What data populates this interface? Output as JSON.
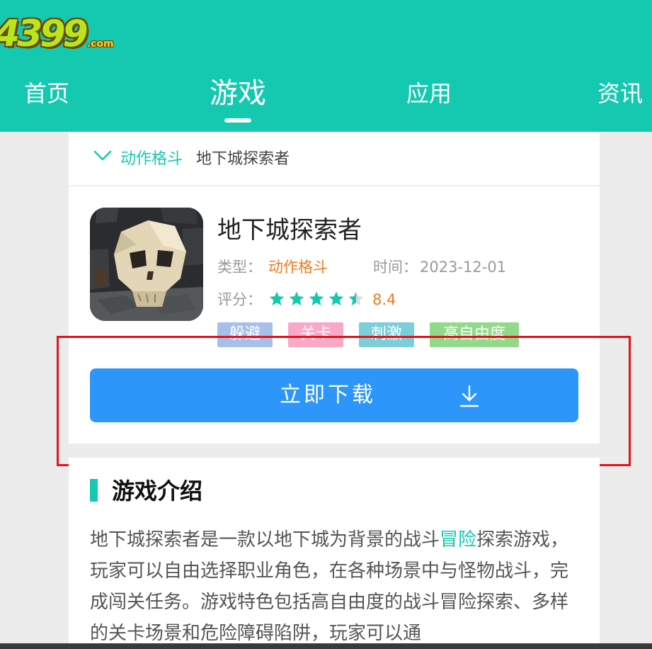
{
  "header": {
    "logo_text": "4399",
    "logo_com": ".com",
    "nav": [
      {
        "label": "首页"
      },
      {
        "label": "游戏"
      },
      {
        "label": "应用"
      },
      {
        "label": "资讯"
      }
    ],
    "active_index": 1,
    "bg_color": "#14c9b0"
  },
  "breadcrumb": {
    "icon": "chevron-down-icon",
    "category": "动作格斗",
    "current": "地下城探索者"
  },
  "game": {
    "title": "地下城探索者",
    "type_label": "类型：",
    "type_value": "动作格斗",
    "time_label": "时间：",
    "time_value": "2023-12-01",
    "rating_label": "评分：",
    "rating_value": "8.4",
    "rating_stars": 4.5,
    "rating_max": 5,
    "tags": [
      {
        "label": "躲避",
        "color": "#a8c0e8"
      },
      {
        "label": "关卡",
        "color": "#f7a9c7"
      },
      {
        "label": "刺激",
        "color": "#7ccfd8"
      },
      {
        "label": "高自由度",
        "color": "#93d98a"
      }
    ],
    "download_label": "立即下载",
    "download_icon": "download-icon"
  },
  "intro": {
    "heading": "游戏介绍",
    "text_before": "地下城探索者是一款以地下城为背景的战斗",
    "link": "冒险",
    "text_after": "探索游戏，玩家可以自由选择职业角色，在各种场景中与怪物战斗，完成闯关任务。游戏特色包括高自由度的战斗冒险探索、多样的关卡场景和危险障碍陷阱，玩家可以通"
  },
  "colors": {
    "accent": "#14c9b0",
    "orange": "#f27a1f",
    "download": "#2c96fb",
    "highlight": "#e4121a",
    "star_on": "#14c9b0",
    "star_off": "#d9d9d9"
  }
}
